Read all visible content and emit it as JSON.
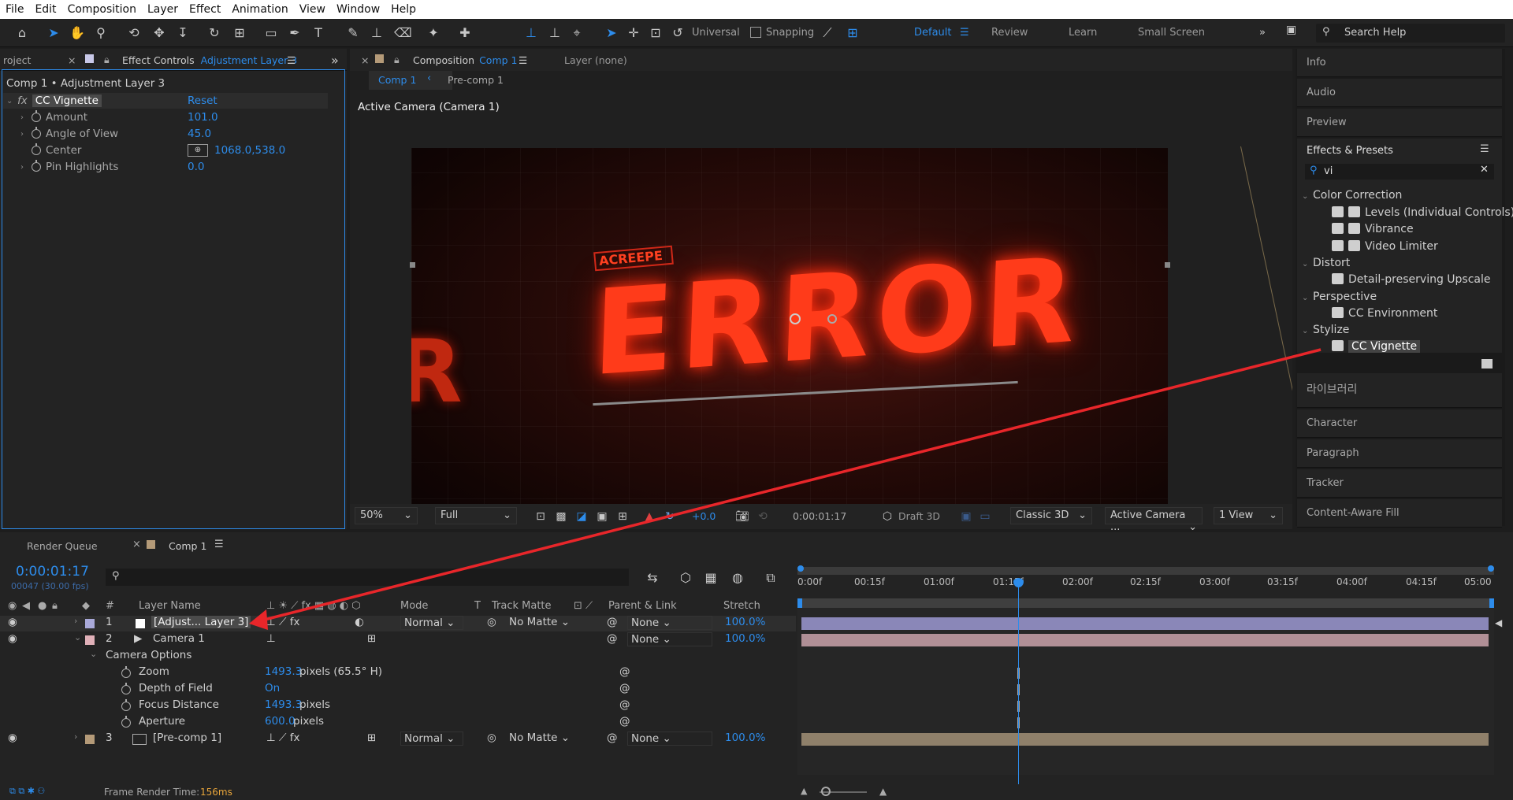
{
  "menu": [
    "File",
    "Edit",
    "Composition",
    "Layer",
    "Effect",
    "Animation",
    "View",
    "Window",
    "Help"
  ],
  "toolbar": {
    "universal_label": "Universal",
    "snapping_label": "Snapping",
    "workspaces": [
      "Default",
      "Review",
      "Learn",
      "Small Screen"
    ],
    "active_workspace": "Default",
    "search_placeholder": "Search Help"
  },
  "effect_controls": {
    "project_tab": "roject",
    "tab_label": "Effect Controls",
    "tab_layer": "Adjustment Layer 3",
    "breadcrumb": "Comp 1 • Adjustment Layer 3",
    "effect_name": "CC Vignette",
    "reset_label": "Reset",
    "properties": [
      {
        "name": "Amount",
        "value": "101.0"
      },
      {
        "name": "Angle of View",
        "value": "45.0"
      },
      {
        "name": "Center",
        "value": "1068.0,538.0"
      },
      {
        "name": "Pin Highlights",
        "value": "0.0"
      }
    ]
  },
  "composition": {
    "tab_label": "Composition",
    "tab_comp": "Comp 1",
    "layer_tab": "Layer (none)",
    "flow_items": [
      "Comp 1",
      "Pre-comp 1"
    ],
    "camera_label": "Active Camera (Camera 1)",
    "viewer_text": "ERROR",
    "viewer_small": "ACREEPE",
    "footer": {
      "zoom": "50%",
      "resolution": "Full",
      "exposure": "+0.0",
      "timecode": "0:00:01:17",
      "draft3d": "Draft 3D",
      "renderer": "Classic 3D",
      "camera": "Active Camera ...",
      "views": "1 View"
    }
  },
  "right_panels": {
    "collapsed_top": [
      "Info",
      "Audio",
      "Preview"
    ],
    "effects_presets": {
      "title": "Effects & Presets",
      "search_value": "vi",
      "groups": [
        {
          "name": "Color Correction",
          "items": [
            "Levels (Individual Controls)",
            "Vibrance",
            "Video Limiter"
          ]
        },
        {
          "name": "Distort",
          "items": [
            "Detail-preserving Upscale"
          ]
        },
        {
          "name": "Perspective",
          "items": [
            "CC Environment"
          ]
        },
        {
          "name": "Stylize",
          "items": [
            "CC Vignette"
          ]
        }
      ],
      "selected": "CC Vignette"
    },
    "library": "라이브러리",
    "collapsed_bottom": [
      "Character",
      "Paragraph",
      "Tracker",
      "Content-Aware Fill"
    ]
  },
  "timeline": {
    "tabs": [
      "Render Queue",
      "Comp 1"
    ],
    "timecode": "0:00:01:17",
    "frame_info": "00047 (30.00 fps)",
    "columns": {
      "layer_name": "Layer Name",
      "mode": "Mode",
      "t": "T",
      "track_matte": "Track Matte",
      "parent": "Parent & Link",
      "stretch": "Stretch",
      "num": "#"
    },
    "ruler": [
      "0:00f",
      "00:15f",
      "01:00f",
      "01:15f",
      "02:00f",
      "02:15f",
      "03:00f",
      "03:15f",
      "04:00f",
      "04:15f",
      "05:00"
    ],
    "playhead_fraction": 0.3167,
    "layers": [
      {
        "num": "1",
        "name": "[Adjust... Layer 3]",
        "label_color": "#a8a8d8",
        "mode": "Normal",
        "matte": "No Matte",
        "parent": "None",
        "stretch": "100.0%",
        "bar_color": "#8a87b8"
      },
      {
        "num": "2",
        "name": "Camera 1",
        "label_color": "#e0b0b8",
        "mode": "",
        "matte": "",
        "parent": "None",
        "stretch": "100.0%",
        "bar_color": "#b08f96"
      },
      {
        "num": "3",
        "name": "[Pre-comp 1]",
        "label_color": "#b49a78",
        "mode": "Normal",
        "matte": "No Matte",
        "parent": "None",
        "stretch": "100.0%",
        "bar_color": "#8f806a"
      }
    ],
    "camera_options": {
      "label": "Camera Options",
      "properties": [
        {
          "name": "Zoom",
          "value": "1493.3",
          "unit": " pixels (65.5° H)"
        },
        {
          "name": "Depth of Field",
          "value": "On",
          "unit": ""
        },
        {
          "name": "Focus Distance",
          "value": "1493.3",
          "unit": " pixels"
        },
        {
          "name": "Aperture",
          "value": "600.0",
          "unit": " pixels"
        }
      ]
    },
    "status": {
      "label": "Frame Render Time:",
      "value": "156ms"
    }
  },
  "colors": {
    "accent": "#2d8ceb",
    "arrow": "#e8262a",
    "panel_border": "#2d8ceb"
  }
}
